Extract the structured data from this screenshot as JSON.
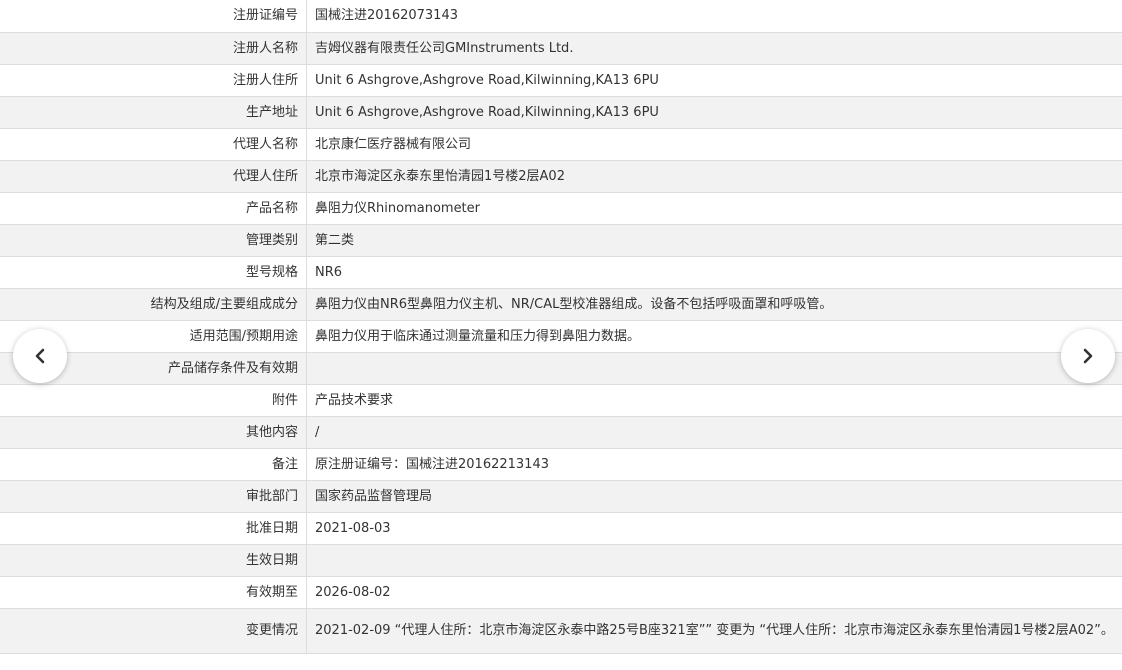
{
  "rows": [
    {
      "label": "注册证编号",
      "value": "国械注进20162073143"
    },
    {
      "label": "注册人名称",
      "value": "吉姆仪器有限责任公司GMInstruments Ltd."
    },
    {
      "label": "注册人住所",
      "value": "Unit 6 Ashgrove,Ashgrove Road,Kilwinning,KA13 6PU"
    },
    {
      "label": "生产地址",
      "value": "Unit 6 Ashgrove,Ashgrove Road,Kilwinning,KA13 6PU"
    },
    {
      "label": "代理人名称",
      "value": "北京康仁医疗器械有限公司"
    },
    {
      "label": "代理人住所",
      "value": "北京市海淀区永泰东里怡清园1号楼2层A02"
    },
    {
      "label": "产品名称",
      "value": "鼻阻力仪Rhinomanometer"
    },
    {
      "label": "管理类别",
      "value": "第二类"
    },
    {
      "label": "型号规格",
      "value": "NR6"
    },
    {
      "label": "结构及组成/主要组成成分",
      "value": "鼻阻力仪由NR6型鼻阻力仪主机、NR/CAL型校准器组成。设备不包括呼吸面罩和呼吸管。"
    },
    {
      "label": "适用范围/预期用途",
      "value": "鼻阻力仪用于临床通过测量流量和压力得到鼻阻力数据。"
    },
    {
      "label": "产品储存条件及有效期",
      "value": ""
    },
    {
      "label": "附件",
      "value": "产品技术要求"
    },
    {
      "label": "其他内容",
      "value": "/"
    },
    {
      "label": "备注",
      "value": "原注册证编号：国械注进20162213143"
    },
    {
      "label": "审批部门",
      "value": "国家药品监督管理局"
    },
    {
      "label": "批准日期",
      "value": "2021-08-03"
    },
    {
      "label": "生效日期",
      "value": ""
    },
    {
      "label": "有效期至",
      "value": "2026-08-02"
    },
    {
      "label": "变更情况",
      "value": "2021-02-09 “代理人住所：北京市海淀区永泰中路25号B座321室”” 变更为 “代理人住所：北京市海淀区永泰东里怡清园1号楼2层A02”。"
    }
  ],
  "navigation": {
    "prev_icon": "chevron-left-icon",
    "next_icon": "chevron-right-icon"
  }
}
